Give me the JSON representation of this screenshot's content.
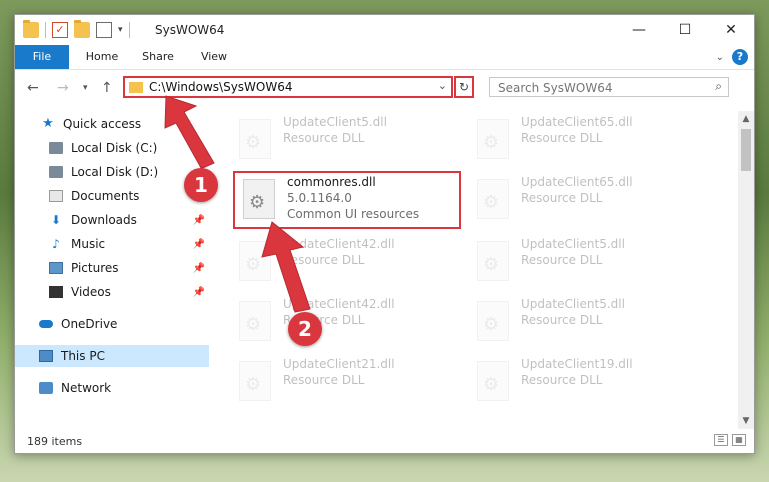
{
  "window": {
    "title": "SysWOW64",
    "controls": {
      "minimize": "—",
      "maximize": "☐",
      "close": "✕"
    }
  },
  "ribbon": {
    "tabs": [
      "File",
      "Home",
      "Share",
      "View"
    ],
    "help": "?"
  },
  "address": {
    "path": "C:\\Windows\\SysWOW64",
    "search_placeholder": "Search SysWOW64"
  },
  "sidebar": {
    "items": [
      {
        "label": "Quick access",
        "icon": "star-icon"
      },
      {
        "label": "Local Disk (C:)",
        "icon": "disk-icon",
        "pinned": true
      },
      {
        "label": "Local Disk (D:)",
        "icon": "disk-icon"
      },
      {
        "label": "Documents",
        "icon": "documents-icon",
        "pinned": true
      },
      {
        "label": "Downloads",
        "icon": "download-icon",
        "pinned": true
      },
      {
        "label": "Music",
        "icon": "music-icon",
        "pinned": true
      },
      {
        "label": "Pictures",
        "icon": "pictures-icon",
        "pinned": true
      },
      {
        "label": "Videos",
        "icon": "videos-icon",
        "pinned": true
      },
      {
        "label": "OneDrive",
        "icon": "onedrive-icon"
      },
      {
        "label": "This PC",
        "icon": "pc-icon",
        "selected": true
      },
      {
        "label": "Network",
        "icon": "network-icon"
      }
    ]
  },
  "files": {
    "highlighted": {
      "name": "commonres.dll",
      "version": "5.0.1164.0",
      "description": "Common UI resources"
    },
    "faded": [
      {
        "name": "UpdateClient5.dll",
        "type": "Resource DLL"
      },
      {
        "name": "UpdateClient65.dll",
        "type": "Resource DLL"
      },
      {
        "name": "UpdateClient65.dll",
        "type": "Resource DLL"
      },
      {
        "name": "UpdateClient42.dll",
        "type": "Resource DLL"
      },
      {
        "name": "UpdateClient5.dll",
        "type": "Resource DLL"
      },
      {
        "name": "UpdateClient42.dll",
        "type": "Resource DLL"
      },
      {
        "name": "UpdateClient5.dll",
        "type": "Resource DLL"
      },
      {
        "name": "UpdateClient21.dll",
        "type": "Resource DLL"
      },
      {
        "name": "UpdateClient19.dll",
        "type": "Resource DLL"
      }
    ]
  },
  "status": {
    "count": "189 items"
  },
  "annotations": {
    "step1": "1",
    "step2": "2",
    "color": "#d9363e"
  }
}
